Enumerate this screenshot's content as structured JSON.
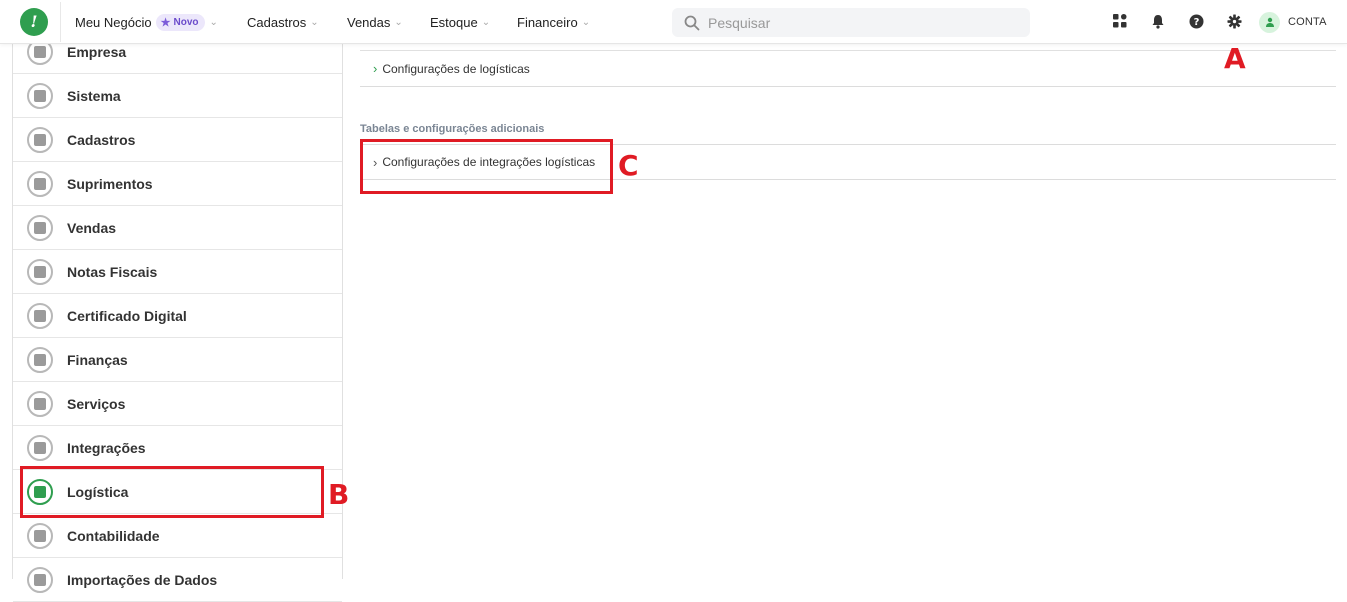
{
  "topbar": {
    "logo_char": "!",
    "nav": [
      {
        "label": "Meu Negócio",
        "badge": "Novo"
      },
      {
        "label": "Cadastros"
      },
      {
        "label": "Vendas"
      },
      {
        "label": "Estoque"
      },
      {
        "label": "Financeiro"
      }
    ],
    "search_placeholder": "Pesquisar",
    "icons": [
      "apps-icon",
      "bell-icon",
      "help-icon",
      "gear-icon"
    ],
    "account_label": "CONTA"
  },
  "sidebar": {
    "items": [
      {
        "label": "Empresa",
        "icon": "building-icon"
      },
      {
        "label": "Sistema",
        "icon": "monitor-icon"
      },
      {
        "label": "Cadastros",
        "icon": "book-icon"
      },
      {
        "label": "Suprimentos",
        "icon": "box-icon"
      },
      {
        "label": "Vendas",
        "icon": "users-icon"
      },
      {
        "label": "Notas Fiscais",
        "icon": "invoice-icon"
      },
      {
        "label": "Certificado Digital",
        "icon": "certificate-icon"
      },
      {
        "label": "Finanças",
        "icon": "piggy-bank-icon"
      },
      {
        "label": "Serviços",
        "icon": "clipboard-icon"
      },
      {
        "label": "Integrações",
        "icon": "integration-icon"
      },
      {
        "label": "Logística",
        "icon": "truck-icon",
        "active": true
      },
      {
        "label": "Contabilidade",
        "icon": "calculator-icon"
      },
      {
        "label": "Importações de Dados",
        "icon": "import-icon"
      }
    ]
  },
  "main": {
    "row1_label": "Configurações de logísticas",
    "section_title": "Tabelas e configurações adicionais",
    "row2_label": "Configurações de integrações logísticas"
  },
  "annotations": {
    "a": "A",
    "b": "B",
    "c": "C"
  },
  "colors": {
    "brand_green": "#2f9e4f",
    "annotation_red": "#e01b24",
    "badge_purple": "#6b4bcb"
  }
}
